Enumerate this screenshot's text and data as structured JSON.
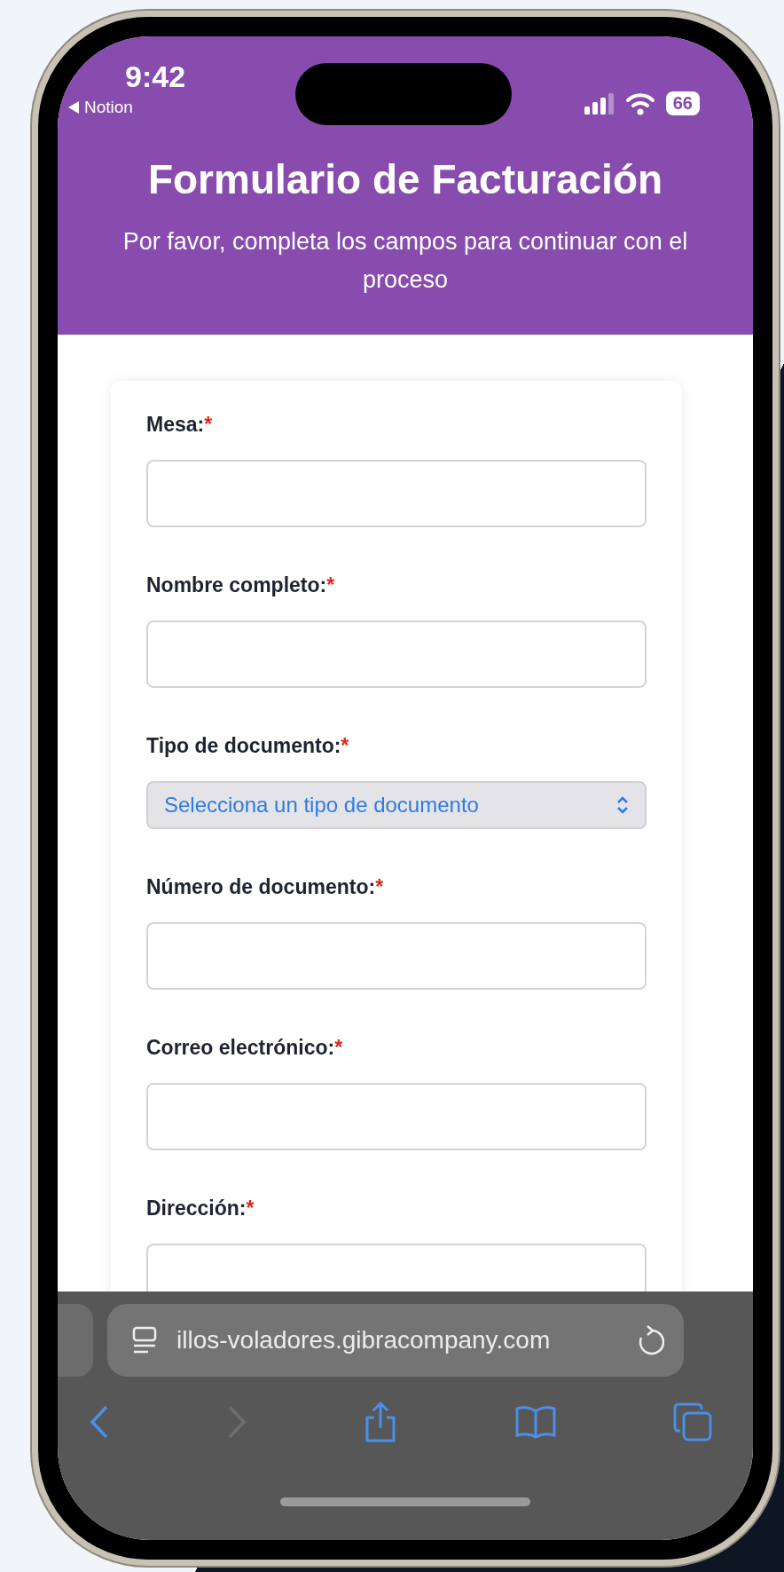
{
  "status_bar": {
    "time": "9:42",
    "back_app": "Notion",
    "battery": "66"
  },
  "header": {
    "title": "Formulario de Facturación",
    "subtitle": "Por favor, completa los campos para continuar con el proceso"
  },
  "form": {
    "fields": [
      {
        "label": "Mesa:",
        "required_mark": "*",
        "kind": "text"
      },
      {
        "label": "Nombre completo:",
        "required_mark": "*",
        "kind": "text"
      },
      {
        "label": "Tipo de documento:",
        "required_mark": "*",
        "kind": "select",
        "value": "Selecciona un tipo de documento"
      },
      {
        "label": "Número de documento:",
        "required_mark": "*",
        "kind": "text"
      },
      {
        "label": "Correo electrónico:",
        "required_mark": "*",
        "kind": "text"
      },
      {
        "label": "Dirección:",
        "required_mark": "*",
        "kind": "text"
      }
    ]
  },
  "browser": {
    "url": "illos-voladores.gibracompany.com",
    "toolbar": [
      {
        "kind": "back",
        "disabled": false
      },
      {
        "kind": "forward",
        "disabled": true
      },
      {
        "kind": "share",
        "disabled": false
      },
      {
        "kind": "bookmarks",
        "disabled": false
      },
      {
        "kind": "tabs",
        "disabled": false
      }
    ]
  }
}
